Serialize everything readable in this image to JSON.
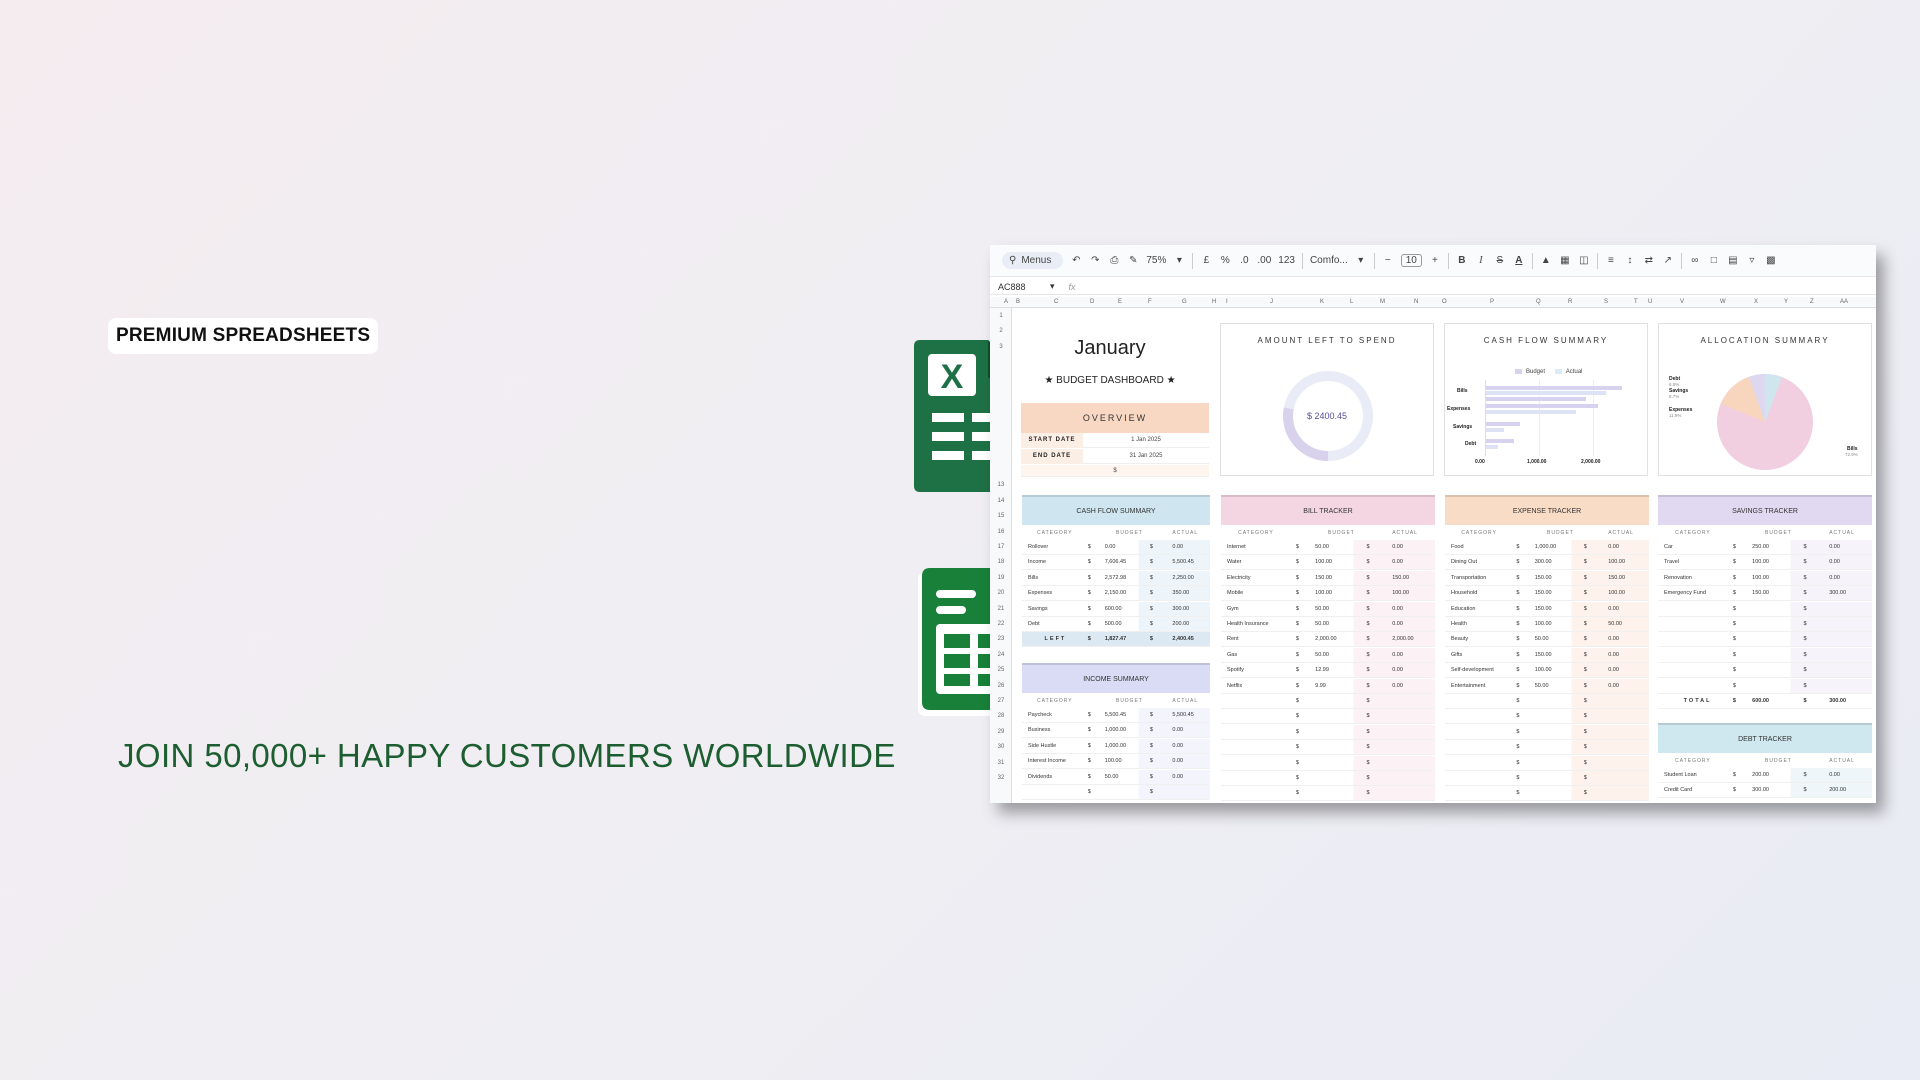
{
  "badge": "PREMIUM SPREADSHEETS",
  "headline": "JOIN 50,000+ HAPPY CUSTOMERS WORLDWIDE",
  "colors": {
    "brand_green": "#1d5e31",
    "excel_green": "#1e7145",
    "sheets_green": "#188038"
  },
  "icons": {
    "excel": "excel-icon",
    "sheets": "google-sheets-icon"
  },
  "sheet": {
    "toolbar": {
      "search": "Menus",
      "zoom": "75%",
      "currency": "£",
      "percent": "%",
      "dec_less": ".0",
      "dec_more": ".00",
      "number_fmt": "123",
      "font": "Comfo...",
      "font_size": "10",
      "minus": "−",
      "plus": "+",
      "bold": "B",
      "italic": "I",
      "strike": "S",
      "textcolor": "A"
    },
    "cell_ref": "AC888",
    "fx": "fx",
    "col_headers": [
      "A",
      "B",
      "C",
      "D",
      "E",
      "F",
      "G",
      "H",
      "I",
      "J",
      "K",
      "L",
      "M",
      "N",
      "O",
      "P",
      "Q",
      "R",
      "S",
      "T",
      "U",
      "V",
      "W",
      "X",
      "Y",
      "Z",
      "AA"
    ],
    "row_headers": [
      "1",
      "2",
      "3",
      "",
      "",
      "",
      "",
      "",
      "",
      "",
      "",
      "13",
      "14",
      "15",
      "16",
      "17",
      "18",
      "19",
      "20",
      "21",
      "22",
      "23",
      "24",
      "25",
      "26",
      "27",
      "28",
      "29",
      "30",
      "31",
      "32"
    ],
    "month": "January",
    "dashboard": "★ BUDGET DASHBOARD ★",
    "overview": "OVERVIEW",
    "start_date_label": "START DATE",
    "start_date": "1 Jan 2025",
    "end_date_label": "END DATE",
    "end_date": "31 Jan 2025",
    "currency_cell": "$",
    "amount_left": {
      "title": "AMOUNT LEFT TO SPEND",
      "value": "$ 2400.45",
      "fraction": 0.72
    },
    "cashflow_chart": {
      "title": "CASH FLOW SUMMARY",
      "legend": [
        "Budget",
        "Actual"
      ],
      "categories": [
        "Bills",
        "Expenses",
        "Savings",
        "Debt"
      ],
      "ticks": [
        "0.00",
        "1,000.00",
        "2,000.00"
      ]
    },
    "allocation": {
      "title": "ALLOCATION SUMMARY",
      "labels": [
        "Debt",
        "Savings",
        "Expenses",
        "Bills"
      ],
      "pcts": [
        "6.5%",
        "8.7%",
        "11.9%",
        "72.9%"
      ]
    },
    "cashflow_summary": {
      "title": "CASH FLOW SUMMARY",
      "cols": [
        "CATEGORY",
        "BUDGET",
        "ACTUAL"
      ],
      "rows": [
        [
          "Rollover",
          "$",
          "0.00",
          "$",
          "0.00"
        ],
        [
          "Income",
          "$",
          "7,606.45",
          "$",
          "5,500.45"
        ],
        [
          "Bills",
          "$",
          "2,572.98",
          "$",
          "2,250.00"
        ],
        [
          "Expenses",
          "$",
          "2,150.00",
          "$",
          "350.00"
        ],
        [
          "Savings",
          "$",
          "600.00",
          "$",
          "300.00"
        ],
        [
          "Debt",
          "$",
          "500.00",
          "$",
          "200.00"
        ]
      ],
      "left_label": "LEFT",
      "left_budget": "1,827.47",
      "left_actual": "2,400.45"
    },
    "income_summary": {
      "title": "INCOME SUMMARY",
      "cols": [
        "CATEGORY",
        "BUDGET",
        "ACTUAL"
      ],
      "rows": [
        [
          "Paycheck",
          "$",
          "5,500.45",
          "$",
          "5,500.45"
        ],
        [
          "Business",
          "$",
          "1,000.00",
          "$",
          "0.00"
        ],
        [
          "Side Hustle",
          "$",
          "1,000.00",
          "$",
          "0.00"
        ],
        [
          "Interest Income",
          "$",
          "100.00",
          "$",
          "0.00"
        ],
        [
          "Dividends",
          "$",
          "50.00",
          "$",
          "0.00"
        ],
        [
          "",
          "$",
          "",
          "$",
          ""
        ]
      ]
    },
    "bill_tracker": {
      "title": "BILL TRACKER",
      "cols": [
        "CATEGORY",
        "BUDGET",
        "ACTUAL"
      ],
      "rows": [
        [
          "Internet",
          "$",
          "50.00",
          "$",
          "0.00"
        ],
        [
          "Water",
          "$",
          "100.00",
          "$",
          "0.00"
        ],
        [
          "Electricity",
          "$",
          "150.00",
          "$",
          "150.00"
        ],
        [
          "Mobile",
          "$",
          "100.00",
          "$",
          "100.00"
        ],
        [
          "Gym",
          "$",
          "50.00",
          "$",
          "0.00"
        ],
        [
          "Health Insurance",
          "$",
          "50.00",
          "$",
          "0.00"
        ],
        [
          "Rent",
          "$",
          "2,000.00",
          "$",
          "2,000.00"
        ],
        [
          "Gas",
          "$",
          "50.00",
          "$",
          "0.00"
        ],
        [
          "Spotify",
          "$",
          "12.99",
          "$",
          "0.00"
        ],
        [
          "Netflix",
          "$",
          "9.99",
          "$",
          "0.00"
        ],
        [
          "",
          "$",
          "",
          "$",
          ""
        ],
        [
          "",
          "$",
          "",
          "$",
          ""
        ],
        [
          "",
          "$",
          "",
          "$",
          ""
        ],
        [
          "",
          "$",
          "",
          "$",
          ""
        ],
        [
          "",
          "$",
          "",
          "$",
          ""
        ],
        [
          "",
          "$",
          "",
          "$",
          ""
        ],
        [
          "",
          "$",
          "",
          "$",
          ""
        ]
      ]
    },
    "expense_tracker": {
      "title": "EXPENSE TRACKER",
      "cols": [
        "CATEGORY",
        "BUDGET",
        "ACTUAL"
      ],
      "rows": [
        [
          "Food",
          "$",
          "1,000.00",
          "$",
          "0.00"
        ],
        [
          "Dining Out",
          "$",
          "300.00",
          "$",
          "100.00"
        ],
        [
          "Transportation",
          "$",
          "150.00",
          "$",
          "150.00"
        ],
        [
          "Household",
          "$",
          "150.00",
          "$",
          "100.00"
        ],
        [
          "Education",
          "$",
          "150.00",
          "$",
          "0.00"
        ],
        [
          "Health",
          "$",
          "100.00",
          "$",
          "50.00"
        ],
        [
          "Beauty",
          "$",
          "50.00",
          "$",
          "0.00"
        ],
        [
          "Gifts",
          "$",
          "150.00",
          "$",
          "0.00"
        ],
        [
          "Self-development",
          "$",
          "100.00",
          "$",
          "0.00"
        ],
        [
          "Entertainment",
          "$",
          "50.00",
          "$",
          "0.00"
        ],
        [
          "",
          "$",
          "",
          "$",
          ""
        ],
        [
          "",
          "$",
          "",
          "$",
          ""
        ],
        [
          "",
          "$",
          "",
          "$",
          ""
        ],
        [
          "",
          "$",
          "",
          "$",
          ""
        ],
        [
          "",
          "$",
          "",
          "$",
          ""
        ],
        [
          "",
          "$",
          "",
          "$",
          ""
        ],
        [
          "",
          "$",
          "",
          "$",
          ""
        ]
      ]
    },
    "savings_tracker": {
      "title": "SAVINGS TRACKER",
      "cols": [
        "CATEGORY",
        "BUDGET",
        "ACTUAL"
      ],
      "rows": [
        [
          "Car",
          "$",
          "250.00",
          "$",
          "0.00"
        ],
        [
          "Travel",
          "$",
          "100.00",
          "$",
          "0.00"
        ],
        [
          "Renovation",
          "$",
          "100.00",
          "$",
          "0.00"
        ],
        [
          "Emergency Fund",
          "$",
          "150.00",
          "$",
          "300.00"
        ],
        [
          "",
          "$",
          "",
          "$",
          ""
        ],
        [
          "",
          "$",
          "",
          "$",
          ""
        ],
        [
          "",
          "$",
          "",
          "$",
          ""
        ],
        [
          "",
          "$",
          "",
          "$",
          ""
        ],
        [
          "",
          "$",
          "",
          "$",
          ""
        ],
        [
          "",
          "$",
          "",
          "$",
          ""
        ]
      ],
      "total_label": "TOTAL",
      "total_budget": "600.00",
      "total_actual": "300.00"
    },
    "debt_tracker": {
      "title": "DEBT TRACKER",
      "cols": [
        "CATEGORY",
        "BUDGET",
        "ACTUAL"
      ],
      "rows": [
        [
          "Student Loan",
          "$",
          "200.00",
          "$",
          "0.00"
        ],
        [
          "Credit Card",
          "$",
          "300.00",
          "$",
          "200.00"
        ]
      ]
    }
  }
}
